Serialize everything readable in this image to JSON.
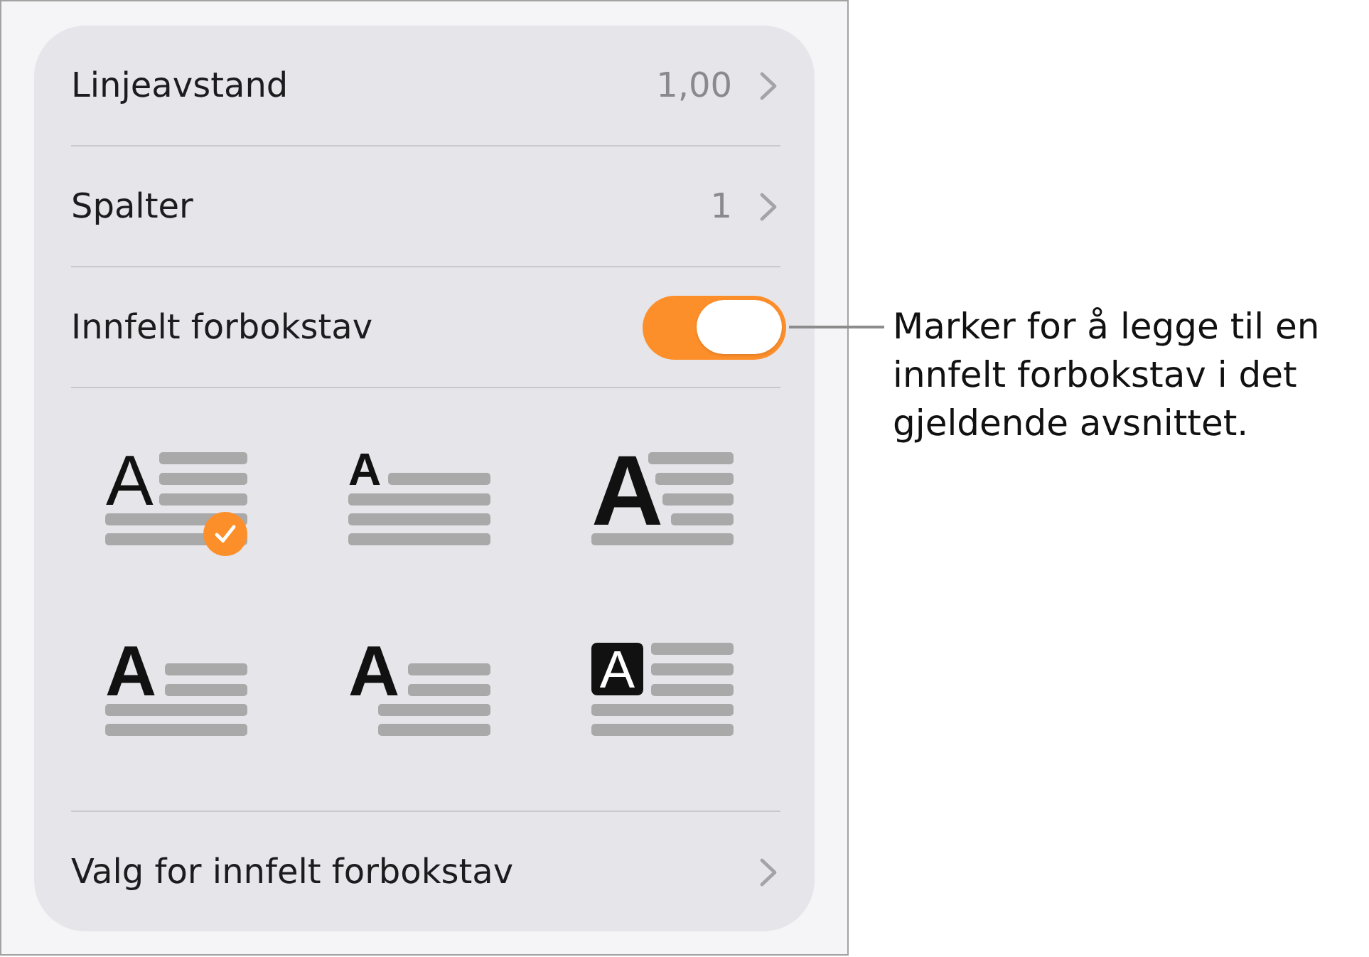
{
  "settings_card": {
    "rows": [
      {
        "kind": "value",
        "label": "Linjeavstand",
        "value": "1,00"
      },
      {
        "kind": "value",
        "label": "Spalter",
        "value": "1"
      },
      {
        "kind": "toggle",
        "label": "Innfelt forbokstav",
        "on": true
      }
    ],
    "drop_cap_styles": [
      {
        "kind": "light",
        "letter": "A",
        "selected": true
      },
      {
        "kind": "raised",
        "letter": "A",
        "selected": false
      },
      {
        "kind": "large",
        "letter": "A",
        "selected": false
      },
      {
        "kind": "dropped",
        "letter": "A",
        "selected": false
      },
      {
        "kind": "hanging",
        "letter": "A",
        "selected": false
      },
      {
        "kind": "boxed",
        "letter": "A",
        "selected": false
      }
    ],
    "options_row": {
      "label": "Valg for innfelt forbokstav"
    }
  },
  "callout": {
    "text": "Marker for å legge til en innfelt forbokstav i det gjeldende avsnittet."
  }
}
